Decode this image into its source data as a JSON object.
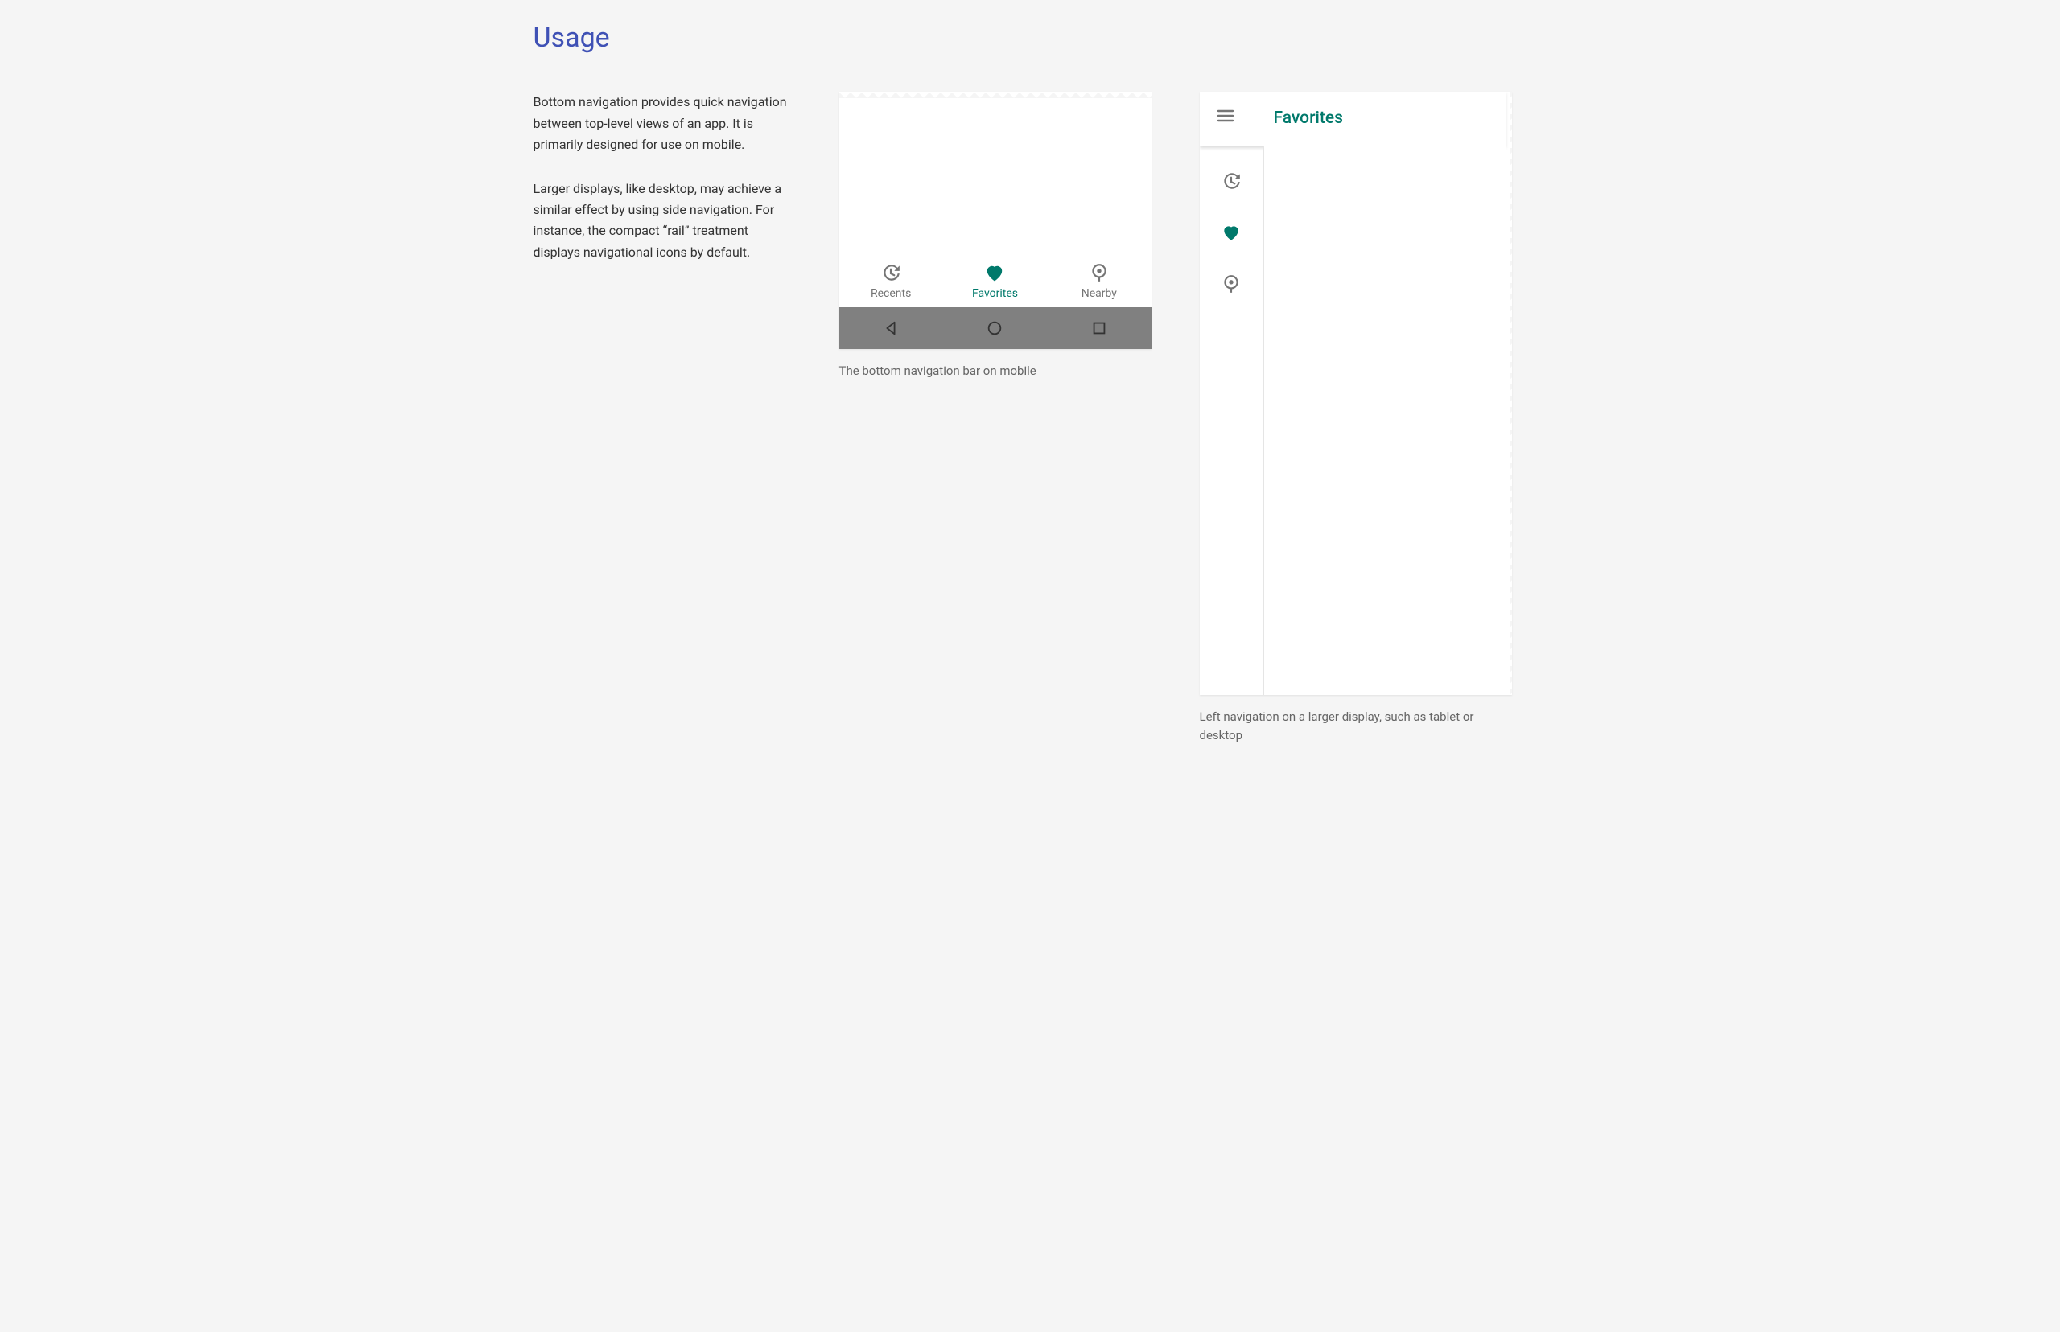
{
  "section_title": "Usage",
  "intro_para1": "Bottom navigation provides quick navigation between top-level views of an app. It is primarily designed for use on mobile.",
  "intro_para2": "Larger displays, like desktop, may achieve a similar effect by using side navigation. For instance, the compact “rail” treatment displays navigational icons by default.",
  "mobile": {
    "nav": [
      {
        "icon": "history-icon",
        "label": "Recents",
        "active": false
      },
      {
        "icon": "heart-icon",
        "label": "Favorites",
        "active": true
      },
      {
        "icon": "location-icon",
        "label": "Nearby",
        "active": false
      }
    ],
    "caption": "The bottom navigation bar on mobile"
  },
  "tablet": {
    "header_title": "Favorites",
    "rail": [
      {
        "icon": "history-icon",
        "active": false
      },
      {
        "icon": "heart-icon",
        "active": true
      },
      {
        "icon": "location-icon",
        "active": false
      }
    ],
    "caption": "Left navigation on a larger display, such as tablet or desktop"
  },
  "colors": {
    "accent": "#00796b",
    "primary": "#3f51b5"
  }
}
